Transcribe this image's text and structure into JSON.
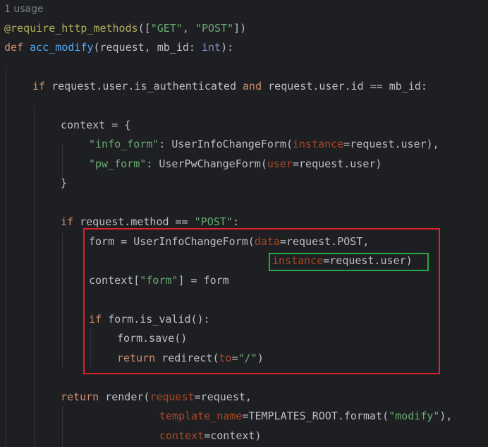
{
  "usage_hint": "1 usage",
  "code": {
    "l1": {
      "dec": "@require_http_methods",
      "p1": "([",
      "s1": "\"GET\"",
      "p2": ", ",
      "s2": "\"POST\"",
      "p3": "])"
    },
    "l2": {
      "kw": "def",
      "sp": " ",
      "fn": "acc_modify",
      "p1": "(request, mb_id: ",
      "bi": "int",
      "p2": "):"
    },
    "l3": {
      "kw": "if",
      "p1": " request.user.is_authenticated ",
      "kw2": "and",
      "p2": " request.user.id == mb_id:"
    },
    "l4": {
      "p1": "context = {"
    },
    "l5": {
      "s": "\"info_form\"",
      "p1": ": UserInfoChangeForm(",
      "param": "instance",
      "p2": "=request.user),"
    },
    "l6": {
      "s": "\"pw_form\"",
      "p1": ": UserPwChangeForm(",
      "param": "user",
      "p2": "=request.user)"
    },
    "l7": {
      "p1": "}"
    },
    "l8": {
      "kw": "if",
      "p1": " request.method == ",
      "s": "\"POST\"",
      "p2": ":"
    },
    "l9": {
      "p1": "form = UserInfoChangeForm(",
      "param": "data",
      "p2": "=request.POST,"
    },
    "l10": {
      "param": "instance",
      "p1": "=request.user)"
    },
    "l11": {
      "p1": "context[",
      "s": "\"form\"",
      "p2": "] = form"
    },
    "l12": {
      "kw": "if",
      "p1": " form.is_valid():"
    },
    "l13": {
      "p1": "form.save()"
    },
    "l14": {
      "kw": "return",
      "p1": " redirect(",
      "param": "to",
      "p2": "=",
      "s": "\"/\"",
      "p3": ")"
    },
    "l15": {
      "kw": "return",
      "p1": " render(",
      "param": "request",
      "p2": "=request,"
    },
    "l16": {
      "param": "template_name",
      "p1": "=TEMPLATES_ROOT.format(",
      "s": "\"modify\"",
      "p2": "),"
    },
    "l17": {
      "param": "context",
      "p1": "=context)"
    }
  },
  "colors": {
    "background": "#1e1f22",
    "red_highlight": "#e0202a",
    "green_highlight": "#29a643"
  }
}
